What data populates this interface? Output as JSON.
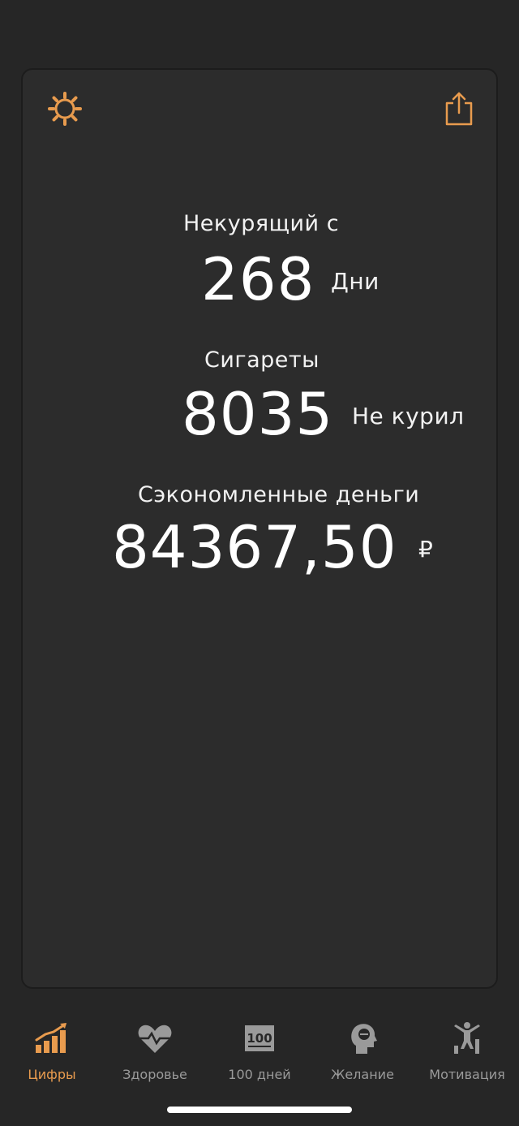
{
  "colors": {
    "accent": "#e89b4e",
    "inactive": "#9a9a9a",
    "background": "#262626",
    "card": "#2c2c2c"
  },
  "header": {
    "settings_icon": "gear-icon",
    "share_icon": "share-icon"
  },
  "stats": {
    "smoke_free": {
      "label": "Некурящий с",
      "value": "268",
      "unit": "Дни"
    },
    "cigarettes": {
      "label": "Сигареты",
      "value": "8035",
      "unit": "Не курил"
    },
    "money": {
      "label": "Сэкономленные деньги",
      "value": "84367,50",
      "unit": "₽"
    }
  },
  "tabs": [
    {
      "label": "Цифры",
      "icon": "chart-icon",
      "active": true
    },
    {
      "label": "Здоровье",
      "icon": "heart-icon",
      "active": false
    },
    {
      "label": "100 дней",
      "icon": "hundred-icon",
      "active": false
    },
    {
      "label": "Желание",
      "icon": "head-icon",
      "active": false
    },
    {
      "label": "Мотивация",
      "icon": "motivation-icon",
      "active": false
    }
  ]
}
